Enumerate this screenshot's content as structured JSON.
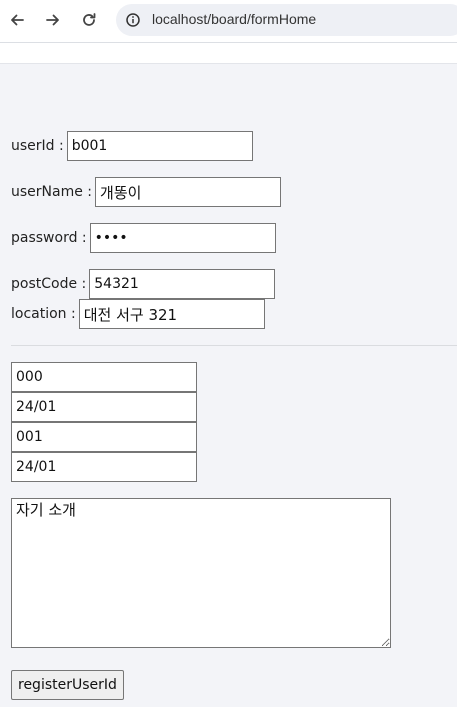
{
  "browser": {
    "url": "localhost/board/formHome",
    "icons": [
      "back-arrow-icon",
      "forward-arrow-icon",
      "reload-icon",
      "site-info-icon"
    ]
  },
  "form": {
    "userId": {
      "label": "userId :",
      "value": "b001"
    },
    "userName": {
      "label": "userName :",
      "value": "개똥이"
    },
    "password": {
      "label": "password :",
      "value": "1234"
    },
    "postCode": {
      "label": "postCode :",
      "value": "54321"
    },
    "location": {
      "label": "location :",
      "value": "대전 서구 321"
    },
    "extra_fields": [
      "000",
      "24/01",
      "001",
      "24/01"
    ],
    "introduction": "자기 소개",
    "submit_label": "registerUserId"
  }
}
